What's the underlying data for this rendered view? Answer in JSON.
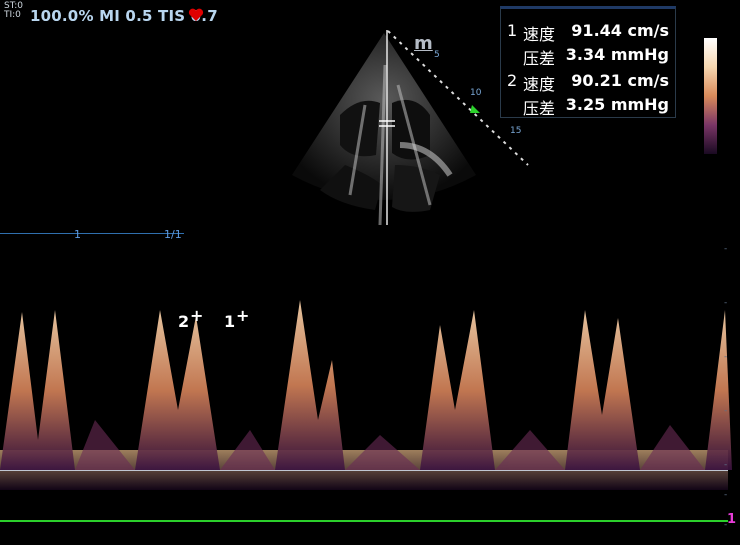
{
  "header": {
    "st_line1": "ST:0",
    "st_line2": "TI:0",
    "status_text": "100.0%  MI 0.5 TIS 0.7",
    "heart_color": "#e00000"
  },
  "measurements": [
    {
      "index": "1",
      "label": "速度",
      "value": "91.44 cm/s"
    },
    {
      "index": "",
      "label": "压差",
      "value": "3.34 mmHg"
    },
    {
      "index": "2",
      "label": "速度",
      "value": "90.21 cm/s"
    },
    {
      "index": "",
      "label": "压差",
      "value": "3.25 mmHg"
    }
  ],
  "image": {
    "mode_marker": "m",
    "depth_labels": [
      "5",
      "10",
      "15"
    ]
  },
  "timeline": {
    "left_label": "1",
    "right_label": "1/1"
  },
  "cursors": [
    {
      "label": "2"
    },
    {
      "label": "1"
    }
  ],
  "colors": {
    "accent": "#1f3a66",
    "baseline": "#bfc6d2",
    "green": "#2bcf2b",
    "pink": "#e83cd8"
  },
  "pink_marker": "1",
  "right_scale_ticks": [
    "-",
    "-",
    "-",
    "-",
    "-",
    "-",
    "-"
  ]
}
